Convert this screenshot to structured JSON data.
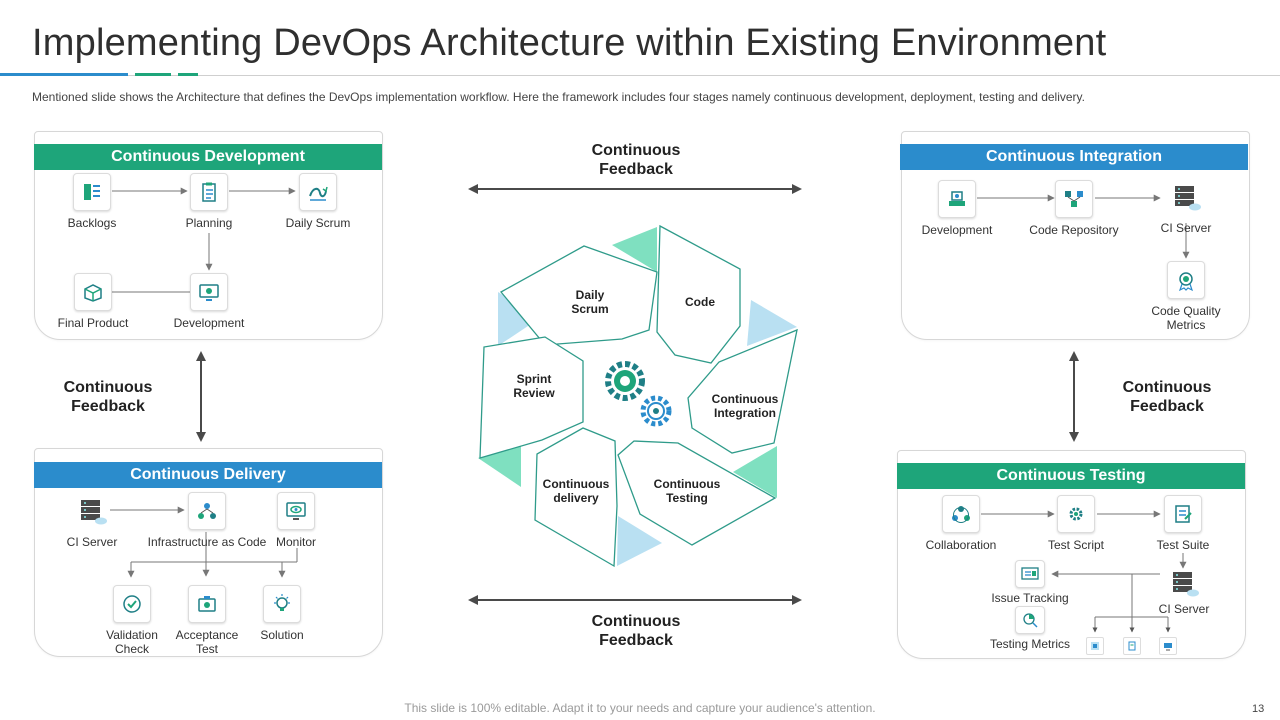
{
  "title": "Implementing DevOps Architecture  within Existing Environment",
  "subtitle": "Mentioned slide shows the Architecture that defines the DevOps  implementation workflow.  Here the framework  includes four  stages namely continuous development,  deployment, testing and delivery.",
  "footer": "This slide is 100% editable. Adapt it to your needs and capture your audience's attention.",
  "page_number": "13",
  "colors": {
    "green": "#1ea57a",
    "blue": "#2b8ccc",
    "mint": "#7fe0c0",
    "light_blue": "#b9e0f2",
    "teal_outline": "#2f9b8a"
  },
  "panels": {
    "development": {
      "header": "Continuous Development",
      "nodes": {
        "backlogs": "Backlogs",
        "planning": "Planning",
        "daily_scrum": "Daily Scrum",
        "final_product": "Final Product",
        "development": "Development"
      }
    },
    "integration": {
      "header": "Continuous Integration",
      "nodes": {
        "development": "Development",
        "code_repository": "Code Repository",
        "ci_server": "CI Server",
        "code_quality_line1": "Code Quality",
        "code_quality_line2": "Metrics"
      }
    },
    "delivery": {
      "header": "Continuous Delivery",
      "nodes": {
        "ci_server": "CI Server",
        "infrastructure": "Infrastructure as Code",
        "monitor": "Monitor",
        "validation_line1": "Validation",
        "validation_line2": "Check",
        "acceptance_line1": "Acceptance",
        "acceptance_line2": "Test",
        "solution": "Solution"
      }
    },
    "testing": {
      "header": "Continuous Testing",
      "nodes": {
        "collaboration": "Collaboration",
        "test_script": "Test Script",
        "test_suite": "Test Suite",
        "issue_tracking": "Issue Tracking",
        "ci_server": "CI Server",
        "testing_metrics": "Testing Metrics"
      }
    }
  },
  "feedback": {
    "top_line1": "Continuous",
    "top_line2": "Feedback",
    "bottom_line1": "Continuous",
    "bottom_line2": "Feedback",
    "left_line1": "Continuous",
    "left_line2": "Feedback",
    "right_line1": "Continuous",
    "right_line2": "Feedback"
  },
  "cycle": {
    "daily_scrum_line1": "Daily",
    "daily_scrum_line2": "Scrum",
    "code": "Code",
    "integration_line1": "Continuous",
    "integration_line2": "Integration",
    "testing_line1": "Continuous",
    "testing_line2": "Testing",
    "delivery_line1": "Continuous",
    "delivery_line2": "delivery",
    "sprint_line1": "Sprint",
    "sprint_line2": "Review"
  },
  "icons": [
    "backlog-icon",
    "planning-icon",
    "daily-scrum-icon",
    "box-icon",
    "monitor-icon",
    "server-icon",
    "repository-icon",
    "badge-icon",
    "checkmark-icon",
    "gear-icon",
    "bug-icon",
    "document-icon"
  ]
}
